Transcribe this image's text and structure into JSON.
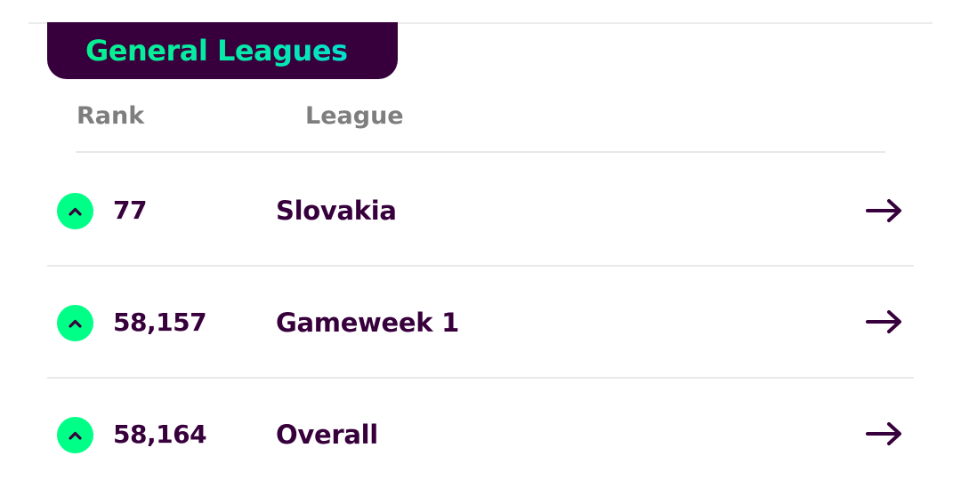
{
  "header": {
    "title": "General Leagues"
  },
  "columns": {
    "rank": "Rank",
    "league": "League"
  },
  "leagues": [
    {
      "rank": "77",
      "name": "Slovakia",
      "movement": "up-icon"
    },
    {
      "rank": "58,157",
      "name": "Gameweek 1",
      "movement": "up-icon"
    },
    {
      "rank": "58,164",
      "name": "Overall",
      "movement": "up-icon"
    }
  ],
  "colors": {
    "brand_purple": "#37003c",
    "movement_up": "#00ff87",
    "header_muted": "#7e7e7e"
  },
  "icons": {
    "movement": "chevron-up-icon",
    "navigate": "arrow-right-icon"
  }
}
